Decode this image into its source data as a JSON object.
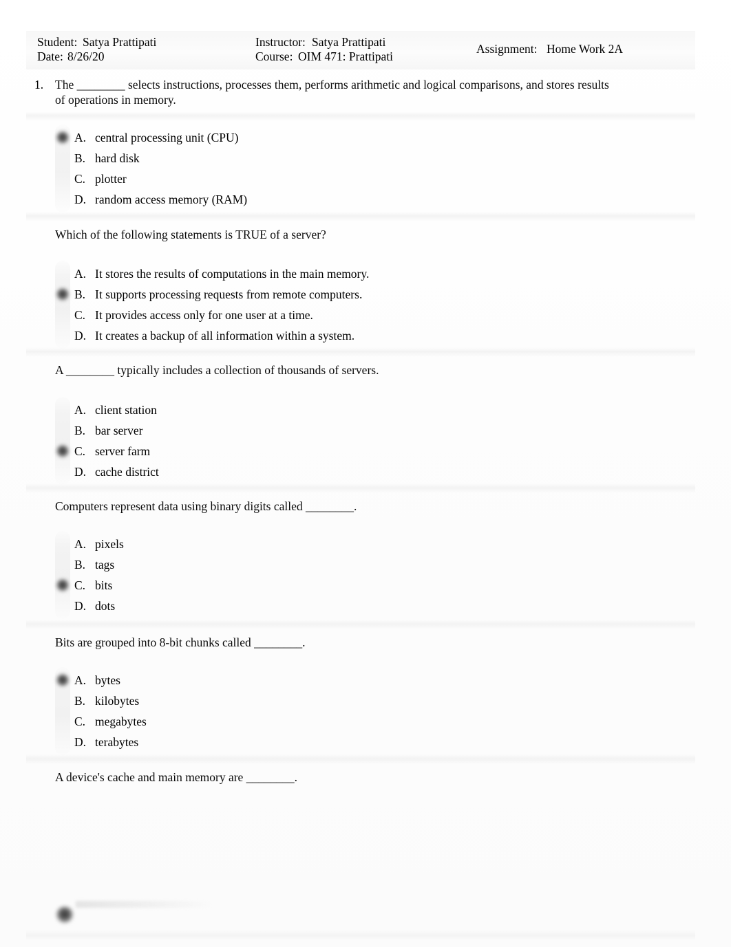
{
  "header": {
    "student_label": "Student:",
    "student_value": "Satya Prattipati",
    "date_label": "Date:",
    "date_value": "8/26/20",
    "instructor_label": "Instructor:",
    "instructor_value": "Satya Prattipati",
    "course_label": "Course:",
    "course_value": "OIM 471: Prattipati",
    "assignment_label": "Assignment:",
    "assignment_value": "Home Work 2A"
  },
  "questions": [
    {
      "number": "1.",
      "text": "The ________ selects instructions, processes them, performs arithmetic and logical comparisons, and stores results of operations in memory.",
      "selected": "A",
      "options": [
        {
          "letter": "A.",
          "text": "central processing unit (CPU)"
        },
        {
          "letter": "B.",
          "text": "hard disk"
        },
        {
          "letter": "C.",
          "text": "plotter"
        },
        {
          "letter": "D.",
          "text": "random access memory (RAM)"
        }
      ]
    },
    {
      "number": "",
      "text": "Which of the following statements is TRUE of a server?",
      "selected": "B",
      "options": [
        {
          "letter": "A.",
          "text": "It stores the results of computations in the main memory."
        },
        {
          "letter": "B.",
          "text": "It supports processing requests from remote computers."
        },
        {
          "letter": "C.",
          "text": "It provides access only for one user at a time."
        },
        {
          "letter": "D.",
          "text": "It creates a backup of all information within a system."
        }
      ]
    },
    {
      "number": "",
      "text": "A ________ typically includes a collection of thousands of servers.",
      "selected": "C",
      "options": [
        {
          "letter": "A.",
          "text": "client station"
        },
        {
          "letter": "B.",
          "text": "bar server"
        },
        {
          "letter": "C.",
          "text": "server farm"
        },
        {
          "letter": "D.",
          "text": "cache district"
        }
      ]
    },
    {
      "number": "",
      "text": "Computers represent data using binary digits called ________.",
      "selected": "C",
      "options": [
        {
          "letter": "A.",
          "text": "pixels"
        },
        {
          "letter": "B.",
          "text": "tags"
        },
        {
          "letter": "C.",
          "text": "bits"
        },
        {
          "letter": "D.",
          "text": "dots"
        }
      ]
    },
    {
      "number": "",
      "text": "Bits are grouped into 8-bit chunks called ________.",
      "selected": "A",
      "options": [
        {
          "letter": "A.",
          "text": "bytes"
        },
        {
          "letter": "B.",
          "text": "kilobytes"
        },
        {
          "letter": "C.",
          "text": "megabytes"
        },
        {
          "letter": "D.",
          "text": "terabytes"
        }
      ]
    },
    {
      "number": "",
      "text": "A device's cache and main memory are ________.",
      "selected": "",
      "options": []
    }
  ]
}
